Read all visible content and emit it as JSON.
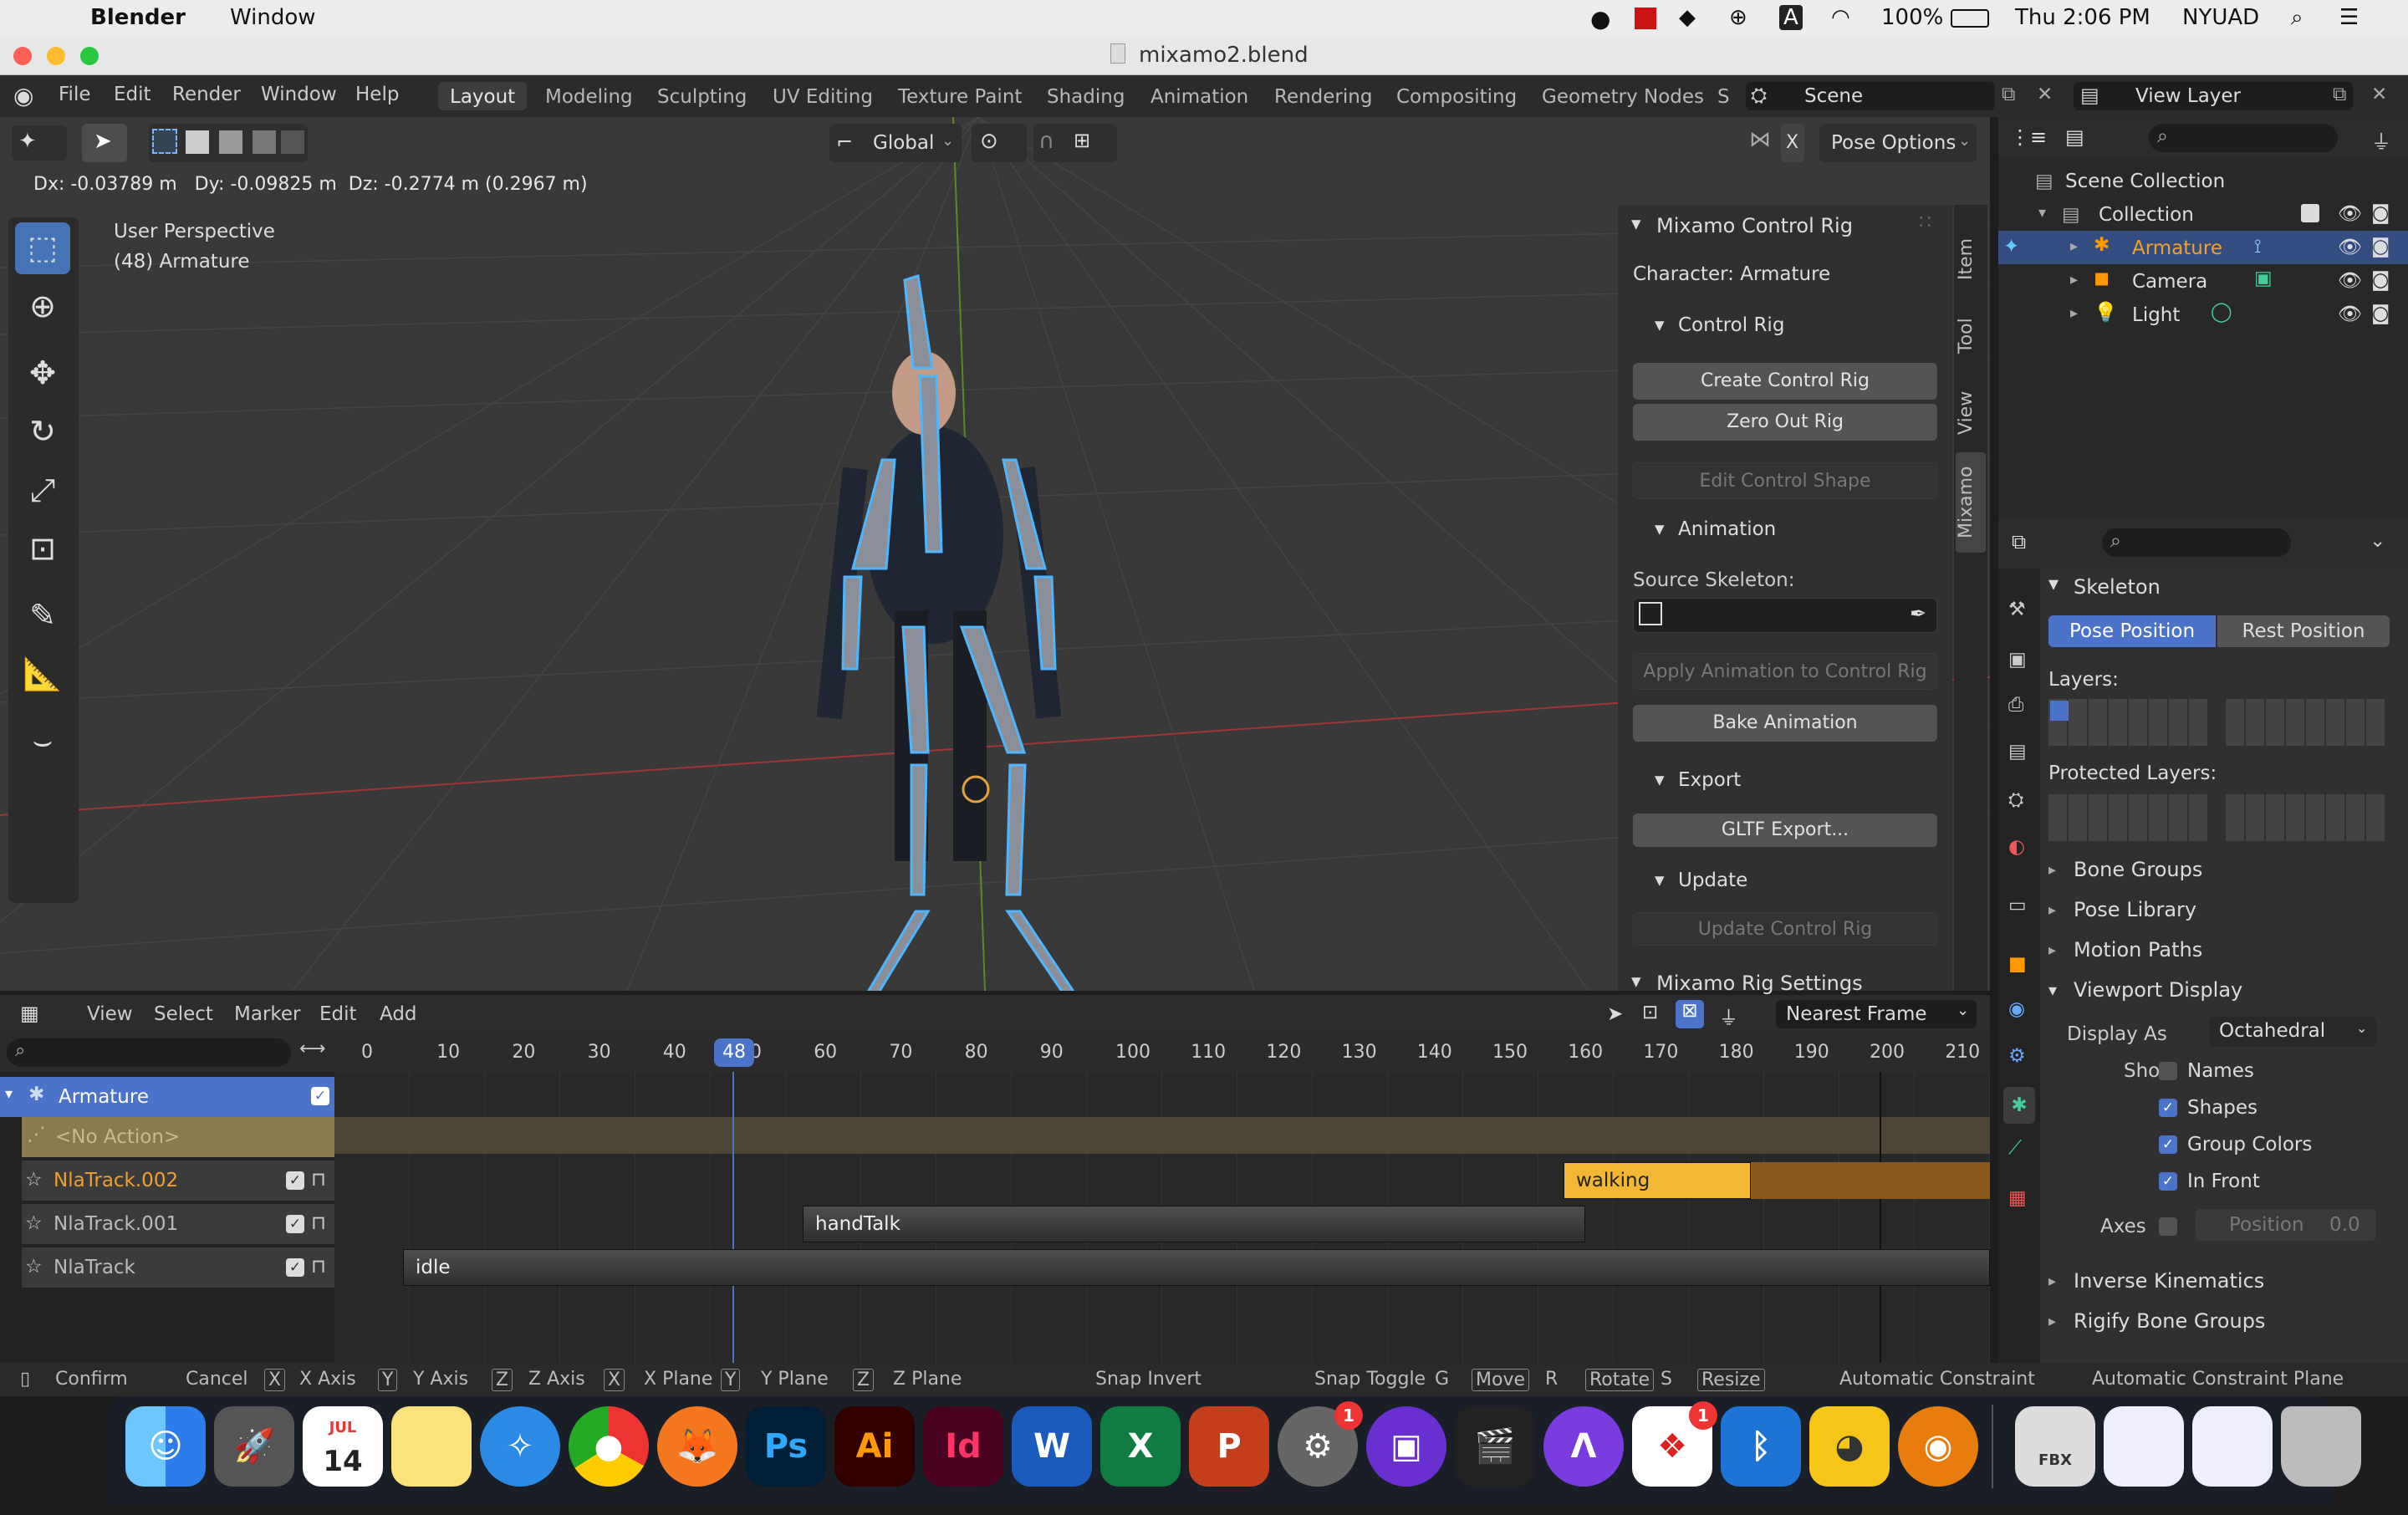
{
  "menubar": {
    "app": "Blender",
    "window": "Window",
    "battery": "100%",
    "clock": "Thu 2:06 PM",
    "user": "NYUAD"
  },
  "title": "mixamo2.blend",
  "topbar": {
    "menus": [
      "File",
      "Edit",
      "Render",
      "Window",
      "Help"
    ],
    "workspaces": [
      "Layout",
      "Modeling",
      "Sculpting",
      "UV Editing",
      "Texture Paint",
      "Shading",
      "Animation",
      "Rendering",
      "Compositing",
      "Geometry Nodes",
      "S"
    ],
    "scene": "Scene",
    "view_layer": "View Layer"
  },
  "viewport": {
    "transform": "Global",
    "pose_options": "Pose Options",
    "readout": "Dx: -0.03789 m   Dy: -0.09825 m  Dz: -0.2774 m (0.2967 m)",
    "persp": "User Perspective",
    "object": "(48) Armature",
    "x_key": "X"
  },
  "npanel": {
    "title": "Mixamo Control Rig",
    "character": "Character: Armature",
    "control_rig": "Control Rig",
    "create": "Create Control Rig",
    "zero": "Zero Out Rig",
    "edit_shape": "Edit Control Shape",
    "animation": "Animation",
    "source_skel": "Source Skeleton:",
    "apply": "Apply Animation to Control Rig",
    "bake": "Bake Animation",
    "export": "Export",
    "gltf": "GLTF Export...",
    "update": "Update",
    "update_rig": "Update Control Rig",
    "settings": "Mixamo Rig Settings",
    "tabs": [
      "Item",
      "Tool",
      "View",
      "Mixamo"
    ]
  },
  "outliner": {
    "scene_collection": "Scene Collection",
    "collection": "Collection",
    "items": [
      "Armature",
      "Camera",
      "Light"
    ]
  },
  "props": {
    "skeleton": "Skeleton",
    "pose_position": "Pose Position",
    "rest_position": "Rest Position",
    "layers": "Layers:",
    "protected_layers": "Protected Layers:",
    "bone_groups": "Bone Groups",
    "pose_library": "Pose Library",
    "motion_paths": "Motion Paths",
    "viewport_display": "Viewport Display",
    "display_as_label": "Display As",
    "display_as": "Octahedral",
    "show": "Show",
    "names": "Names",
    "shapes": "Shapes",
    "group_colors": "Group Colors",
    "in_front": "In Front",
    "axes": "Axes",
    "position": "Position",
    "position_val": "0.0",
    "ik": "Inverse Kinematics",
    "rigify": "Rigify Bone Groups"
  },
  "nla": {
    "menus": [
      "View",
      "Select",
      "Marker",
      "Edit",
      "Add"
    ],
    "snap": "Nearest Frame",
    "current_frame": "48",
    "ticks": [
      "0",
      "10",
      "20",
      "30",
      "40",
      "50",
      "60",
      "70",
      "80",
      "90",
      "100",
      "110",
      "120",
      "130",
      "140",
      "150",
      "160",
      "170",
      "180",
      "190",
      "200",
      "210"
    ],
    "channels": [
      "Armature",
      "<No Action>",
      "NlaTrack.002",
      "NlaTrack.001",
      "NlaTrack"
    ],
    "strips": [
      "walking",
      "handTalk",
      "idle"
    ]
  },
  "statusbar": [
    "Confirm",
    "Cancel",
    "X",
    "X Axis",
    "Y",
    "Y Axis",
    "Z",
    "Z Axis",
    "X",
    "X Plane",
    "Y",
    "Y Plane",
    "Z",
    "Z Plane",
    "Snap Invert",
    "Snap Toggle",
    "G",
    "Move",
    "R",
    "Rotate",
    "S",
    "Resize",
    "Automatic Constraint",
    "Automatic Constraint Plane"
  ],
  "dock": {
    "cal_month": "JUL",
    "cal_day": "14",
    "ps": "Ps",
    "ai": "Ai",
    "id": "Id",
    "w": "W",
    "x": "X",
    "p": "P",
    "fbx": "FBX",
    "badge1": "1",
    "badge2": "1"
  }
}
